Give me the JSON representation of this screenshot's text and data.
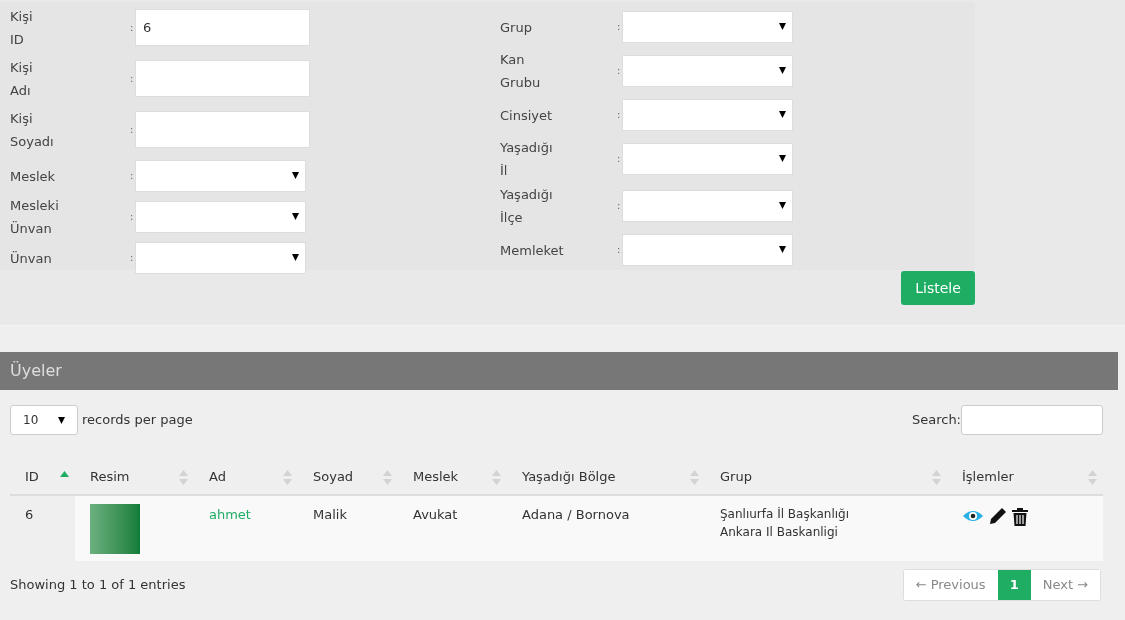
{
  "filter_form": {
    "left_fields": [
      {
        "label": "Kişi ID",
        "kind": "text",
        "value": "6"
      },
      {
        "label": "Kişi Adı",
        "kind": "text"
      },
      {
        "label": "Kişi Soyadı",
        "kind": "text"
      },
      {
        "label": "Meslek",
        "kind": "select"
      },
      {
        "label": "Mesleki Ünvan",
        "kind": "select"
      },
      {
        "label": "Ünvan",
        "kind": "select"
      }
    ],
    "right_fields": [
      {
        "label": "Grup",
        "kind": "select"
      },
      {
        "label": "Kan Grubu",
        "kind": "select"
      },
      {
        "label": "Cinsiyet",
        "kind": "select"
      },
      {
        "label": "Yaşadığı İl",
        "kind": "select"
      },
      {
        "label": "Yaşadığı İlçe",
        "kind": "select"
      },
      {
        "label": "Memleket",
        "kind": "select"
      }
    ],
    "separator": ":",
    "submit_button": "Listele"
  },
  "members_panel": {
    "title": "Üyeler",
    "page_length": {
      "value": "10",
      "label": "records per page"
    },
    "search_label": "Search:",
    "table": {
      "columns": [
        {
          "label": "ID",
          "sorted": true
        },
        {
          "label": "Resim",
          "sorted": false
        },
        {
          "label": "Ad",
          "sorted": false
        },
        {
          "label": "Soyad",
          "sorted": false
        },
        {
          "label": "Meslek",
          "sorted": false
        },
        {
          "label": "Yaşadığı Bölge",
          "sorted": false
        },
        {
          "label": "Grup",
          "sorted": false
        },
        {
          "label": "İşlemler",
          "sorted": false
        }
      ],
      "rows": [
        {
          "id": "6",
          "first_name": "ahmet",
          "last_name": "Malik",
          "profession": "Avukat",
          "region": "Adana / Bornova",
          "groups": [
            "Şanlıurfa İl Başkanlığı",
            "Ankara Il Baskanligi"
          ]
        }
      ]
    },
    "info": "Showing 1 to 1 of 1 entries",
    "pagination": [
      {
        "label": "← Previous",
        "selected": false
      },
      {
        "label": "1",
        "selected": true
      },
      {
        "label": "Next →",
        "selected": false
      }
    ]
  }
}
